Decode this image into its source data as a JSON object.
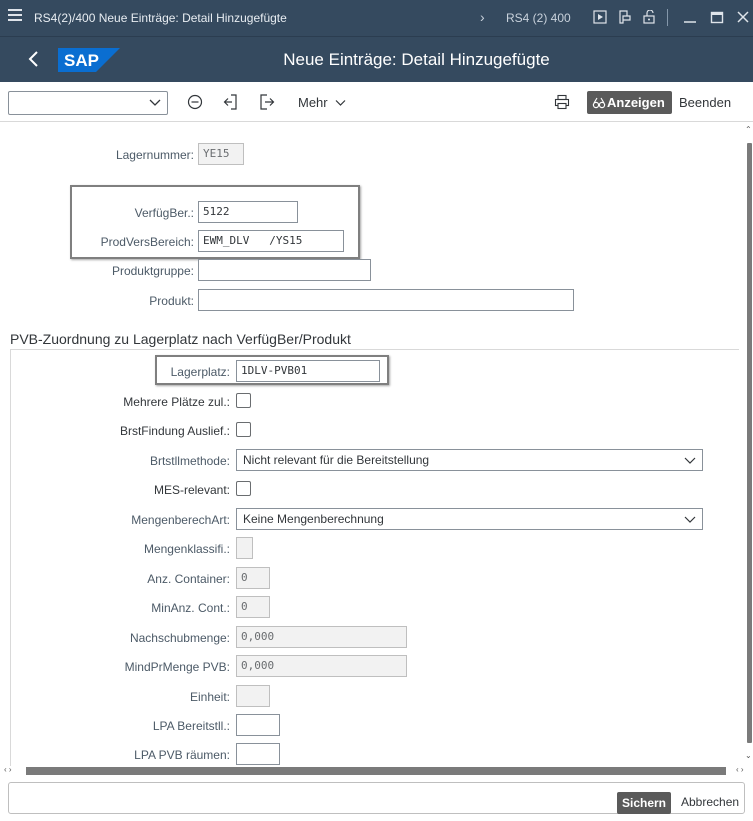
{
  "window": {
    "title": "RS4(2)/400 Neue Einträge: Detail Hinzugefügte",
    "system": "RS4 (2) 400"
  },
  "header": {
    "page_title": "Neue Einträge: Detail Hinzugefügte"
  },
  "toolbar": {
    "select_value": "",
    "more_label": "Mehr",
    "display_label": "Anzeigen",
    "exit_label": "Beenden"
  },
  "form": {
    "lagernummer": {
      "label": "Lagernummer:",
      "value": "YE15"
    },
    "verfuegber": {
      "label": "VerfügBer.:",
      "value": "5122"
    },
    "prodversbereich": {
      "label": "ProdVersBereich:",
      "value": "EWM_DLV   /YS15"
    },
    "produktgruppe": {
      "label": "Produktgruppe:",
      "value": ""
    },
    "produkt": {
      "label": "Produkt:",
      "value": ""
    }
  },
  "section": {
    "title": "PVB-Zuordnung zu Lagerplatz nach VerfügBer/Produkt",
    "lagerplatz": {
      "label": "Lagerplatz:",
      "value": "1DLV-PVB01"
    },
    "mehrere_plaetze": {
      "label": "Mehrere Plätze zul.:",
      "checked": false
    },
    "brstfindung": {
      "label": "BrstFindung Auslief.:",
      "checked": false
    },
    "brtstllmethode": {
      "label": "Brtstllmethode:",
      "value": "Nicht relevant für die Bereitstellung"
    },
    "mes_relevant": {
      "label": "MES-relevant:",
      "checked": false
    },
    "mengenberechart": {
      "label": "MengenberechArt:",
      "value": "Keine Mengenberechnung"
    },
    "mengenklassifi": {
      "label": "Mengenklassifi.:",
      "value": ""
    },
    "anz_container": {
      "label": "Anz. Container:",
      "value": "0"
    },
    "minanz_cont": {
      "label": "MinAnz. Cont.:",
      "value": "0"
    },
    "nachschubmenge": {
      "label": "Nachschubmenge:",
      "value": "0,000"
    },
    "mindprmenge": {
      "label": "MindPrMenge PVB:",
      "value": "0,000"
    },
    "einheit": {
      "label": "Einheit:",
      "value": ""
    },
    "lpa_bereitstll": {
      "label": "LPA Bereitstll.:",
      "value": ""
    },
    "lpa_pvb_raeumen": {
      "label": "LPA PVB räumen:",
      "value": ""
    }
  },
  "footer": {
    "save_label": "Sichern",
    "cancel_label": "Abbrechen"
  },
  "colors": {
    "shell": "#354a5f",
    "emphasized_button": "#5a5a5a",
    "sap_logo": "#0a6ed1"
  }
}
